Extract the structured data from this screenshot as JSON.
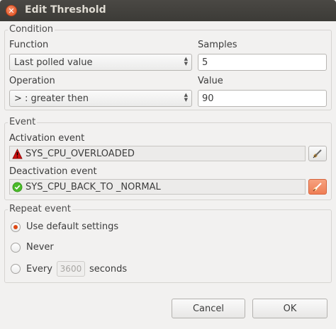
{
  "window": {
    "title": "Edit Threshold"
  },
  "condition": {
    "group_title": "Condition",
    "function_label": "Function",
    "function_value": "Last polled value",
    "samples_label": "Samples",
    "samples_value": "5",
    "operation_label": "Operation",
    "operation_value": "> : greater then",
    "value_label": "Value",
    "value_value": "90"
  },
  "event": {
    "group_title": "Event",
    "activation_label": "Activation event",
    "activation_value": "SYS_CPU_OVERLOADED",
    "activation_icon": "warning-triangle-icon",
    "deactivation_label": "Deactivation event",
    "deactivation_value": "SYS_CPU_BACK_TO _NORMAL",
    "deactivation_icon": "check-circle-icon",
    "accent_color": "#ef7e55"
  },
  "repeat": {
    "group_title": "Repeat event",
    "options": [
      {
        "label": "Use default settings",
        "checked": true
      },
      {
        "label": "Never",
        "checked": false
      },
      {
        "label": "Every",
        "checked": false
      }
    ],
    "interval_value": "3600",
    "interval_unit": "seconds"
  },
  "buttons": {
    "cancel": "Cancel",
    "ok": "OK"
  }
}
